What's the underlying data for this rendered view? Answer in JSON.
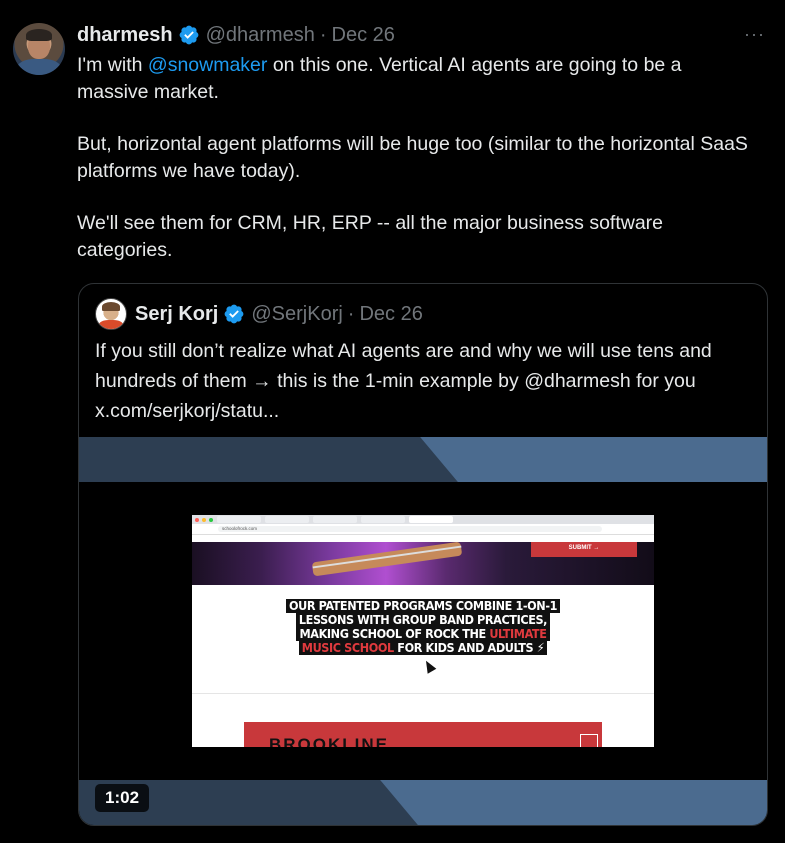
{
  "tweet": {
    "author_name": "dharmesh",
    "author_handle": "@dharmesh",
    "date": "Dec 26",
    "separator": "·",
    "more_label": "···",
    "text_prefix": "I'm with ",
    "mention": "@snowmaker",
    "text_suffix": " on this one.  Vertical AI agents are going to be a massive market.",
    "paragraph2": "But, horizontal agent platforms will be huge too (similar to the horizontal SaaS platforms we have today).",
    "paragraph3": "We'll see them for CRM, HR, ERP -- all the major business software categories."
  },
  "quote": {
    "author_name": "Serj Korj",
    "author_handle": "@SerjKorj",
    "date": "Dec 26",
    "separator": "·",
    "text": "If you still don’t realize what AI agents are and why we will use tens and hundreds of them → this is the 1-min example by @dharmesh for you x.com/serjkorj/statu..."
  },
  "video": {
    "duration": "1:02",
    "browser": {
      "url": "schoolofrock.com",
      "submit_label": "SUBMIT →",
      "pitch_lines": [
        {
          "plain": "OUR PATENTED PROGRAMS COMBINE 1-ON-1",
          "red": ""
        },
        {
          "plain": "LESSONS WITH GROUP BAND PRACTICES,",
          "red": ""
        },
        {
          "plain": "MAKING SCHOOL OF ROCK THE ",
          "red": "ULTIMATE"
        },
        {
          "red": "MUSIC SCHOOL",
          "plain": " FOR KIDS AND ADULTS ⚡"
        }
      ],
      "banner_text": "BROOKLINE"
    }
  },
  "colors": {
    "background": "#000000",
    "mention": "#1d9bf0",
    "verified": "#1d9bf0",
    "muted": "#71767b",
    "accent_red": "#c8383b"
  },
  "icons": {
    "verified": "verified-badge-icon",
    "more": "more-horizontal-icon",
    "cursor": "mouse-cursor-icon"
  }
}
